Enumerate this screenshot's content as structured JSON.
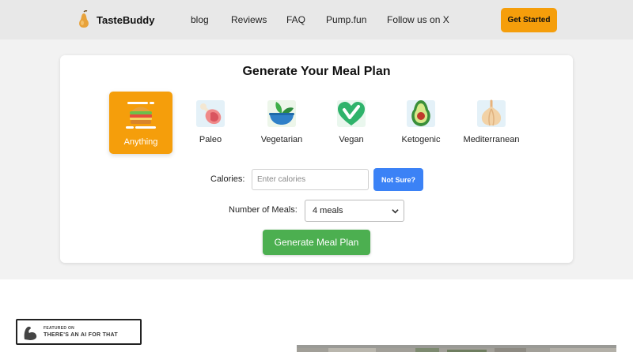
{
  "header": {
    "brand": "TasteBuddy",
    "nav": [
      "blog",
      "Reviews",
      "FAQ",
      "Pump.fun",
      "Follow us on X"
    ],
    "cta_label": "Get Started"
  },
  "card": {
    "title": "Generate Your Meal Plan",
    "diets": [
      {
        "label": "Anything",
        "icon": "sandwich-icon",
        "selected": true
      },
      {
        "label": "Paleo",
        "icon": "meat-icon",
        "selected": false
      },
      {
        "label": "Vegetarian",
        "icon": "salad-bowl-icon",
        "selected": false
      },
      {
        "label": "Vegan",
        "icon": "vegan-heart-icon",
        "selected": false
      },
      {
        "label": "Ketogenic",
        "icon": "avocado-icon",
        "selected": false
      },
      {
        "label": "Mediterranean",
        "icon": "garlic-icon",
        "selected": false
      }
    ],
    "calories_label": "Calories:",
    "calories_placeholder": "Enter calories",
    "not_sure_label": "Not Sure?",
    "meals_label": "Number of Meals:",
    "meals_value": "4 meals",
    "generate_label": "Generate Meal Plan"
  },
  "badge": {
    "small": "FEATURED ON",
    "big": "THERE'S AN AI FOR THAT"
  },
  "colors": {
    "accent": "#f59e0b",
    "blue": "#3b82f6",
    "green": "#4caf50"
  }
}
